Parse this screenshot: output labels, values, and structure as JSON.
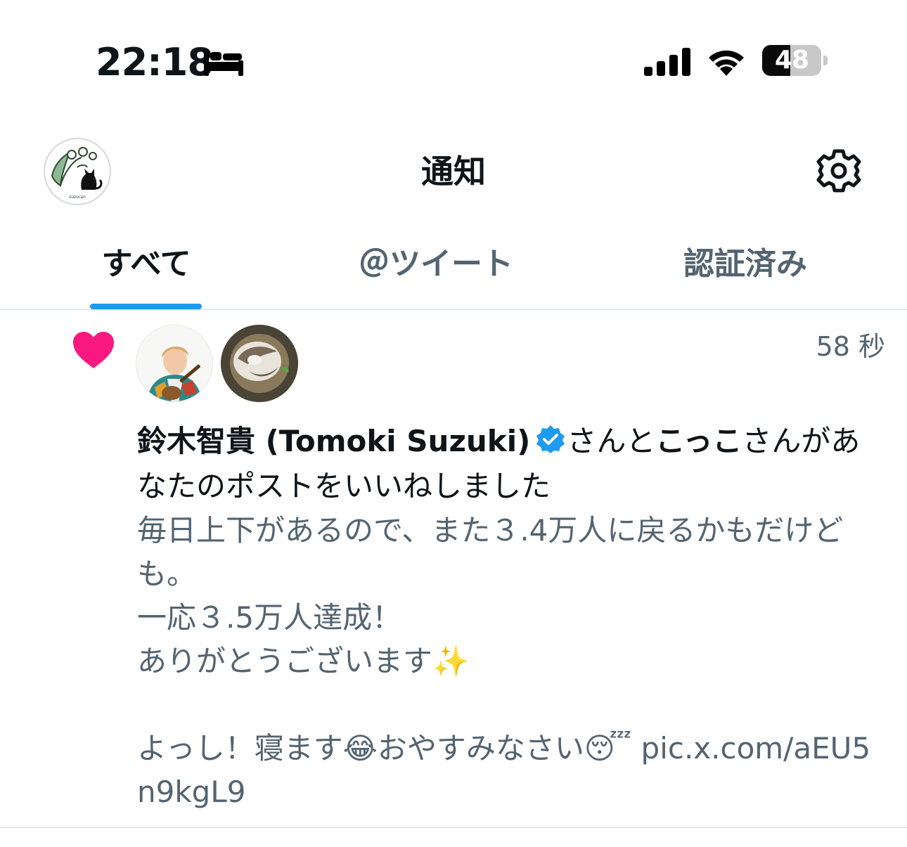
{
  "status_bar": {
    "time": "22:18",
    "battery_level": "48",
    "battery_fraction": 0.48,
    "icons": [
      "bed-icon",
      "signal-icon",
      "wifi-icon",
      "battery-icon"
    ]
  },
  "header": {
    "title": "通知",
    "avatar_icon": "cat-logo-avatar",
    "settings_icon": "gear-icon"
  },
  "tabs": [
    {
      "label": "すべて",
      "active": true
    },
    {
      "label": "＠ツイート",
      "active": false
    },
    {
      "label": "認証済み",
      "active": false
    }
  ],
  "notification": {
    "type_icon": "heart-icon",
    "timestamp": "58 秒",
    "user1_name": "鈴木智貴 (Tomoki Suzuki)",
    "conj": "さんと",
    "user2_name": "こっこ",
    "action": "さんがあなたのポストをいいねしました",
    "tweet_text": "毎日上下があるので、また３.4万人に戻るかもだけども。\n一応３.5万人達成！\nありがとうございます✨\n\nよっし！寝ます😂おやすみなさい😴 pic.x.com/aEU5n9kgL9"
  },
  "colors": {
    "accent": "#1d9bf0",
    "like": "#f91880",
    "secondary_text": "#536471"
  }
}
